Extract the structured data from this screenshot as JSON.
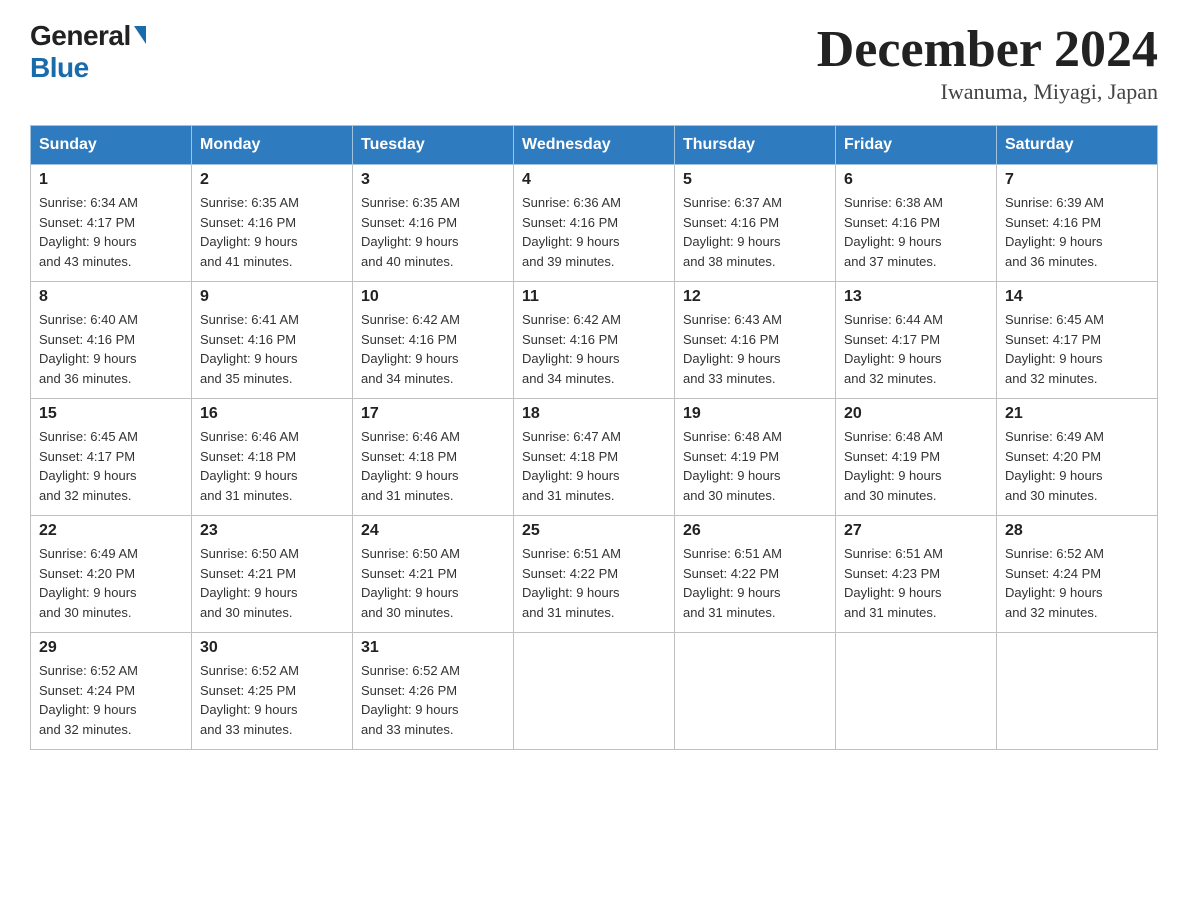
{
  "logo": {
    "line1": "General",
    "line2": "Blue"
  },
  "title": "December 2024",
  "subtitle": "Iwanuma, Miyagi, Japan",
  "weekdays": [
    "Sunday",
    "Monday",
    "Tuesday",
    "Wednesday",
    "Thursday",
    "Friday",
    "Saturday"
  ],
  "weeks": [
    [
      {
        "day": "1",
        "sunrise": "6:34 AM",
        "sunset": "4:17 PM",
        "daylight": "9 hours and 43 minutes."
      },
      {
        "day": "2",
        "sunrise": "6:35 AM",
        "sunset": "4:16 PM",
        "daylight": "9 hours and 41 minutes."
      },
      {
        "day": "3",
        "sunrise": "6:35 AM",
        "sunset": "4:16 PM",
        "daylight": "9 hours and 40 minutes."
      },
      {
        "day": "4",
        "sunrise": "6:36 AM",
        "sunset": "4:16 PM",
        "daylight": "9 hours and 39 minutes."
      },
      {
        "day": "5",
        "sunrise": "6:37 AM",
        "sunset": "4:16 PM",
        "daylight": "9 hours and 38 minutes."
      },
      {
        "day": "6",
        "sunrise": "6:38 AM",
        "sunset": "4:16 PM",
        "daylight": "9 hours and 37 minutes."
      },
      {
        "day": "7",
        "sunrise": "6:39 AM",
        "sunset": "4:16 PM",
        "daylight": "9 hours and 36 minutes."
      }
    ],
    [
      {
        "day": "8",
        "sunrise": "6:40 AM",
        "sunset": "4:16 PM",
        "daylight": "9 hours and 36 minutes."
      },
      {
        "day": "9",
        "sunrise": "6:41 AM",
        "sunset": "4:16 PM",
        "daylight": "9 hours and 35 minutes."
      },
      {
        "day": "10",
        "sunrise": "6:42 AM",
        "sunset": "4:16 PM",
        "daylight": "9 hours and 34 minutes."
      },
      {
        "day": "11",
        "sunrise": "6:42 AM",
        "sunset": "4:16 PM",
        "daylight": "9 hours and 34 minutes."
      },
      {
        "day": "12",
        "sunrise": "6:43 AM",
        "sunset": "4:16 PM",
        "daylight": "9 hours and 33 minutes."
      },
      {
        "day": "13",
        "sunrise": "6:44 AM",
        "sunset": "4:17 PM",
        "daylight": "9 hours and 32 minutes."
      },
      {
        "day": "14",
        "sunrise": "6:45 AM",
        "sunset": "4:17 PM",
        "daylight": "9 hours and 32 minutes."
      }
    ],
    [
      {
        "day": "15",
        "sunrise": "6:45 AM",
        "sunset": "4:17 PM",
        "daylight": "9 hours and 32 minutes."
      },
      {
        "day": "16",
        "sunrise": "6:46 AM",
        "sunset": "4:18 PM",
        "daylight": "9 hours and 31 minutes."
      },
      {
        "day": "17",
        "sunrise": "6:46 AM",
        "sunset": "4:18 PM",
        "daylight": "9 hours and 31 minutes."
      },
      {
        "day": "18",
        "sunrise": "6:47 AM",
        "sunset": "4:18 PM",
        "daylight": "9 hours and 31 minutes."
      },
      {
        "day": "19",
        "sunrise": "6:48 AM",
        "sunset": "4:19 PM",
        "daylight": "9 hours and 30 minutes."
      },
      {
        "day": "20",
        "sunrise": "6:48 AM",
        "sunset": "4:19 PM",
        "daylight": "9 hours and 30 minutes."
      },
      {
        "day": "21",
        "sunrise": "6:49 AM",
        "sunset": "4:20 PM",
        "daylight": "9 hours and 30 minutes."
      }
    ],
    [
      {
        "day": "22",
        "sunrise": "6:49 AM",
        "sunset": "4:20 PM",
        "daylight": "9 hours and 30 minutes."
      },
      {
        "day": "23",
        "sunrise": "6:50 AM",
        "sunset": "4:21 PM",
        "daylight": "9 hours and 30 minutes."
      },
      {
        "day": "24",
        "sunrise": "6:50 AM",
        "sunset": "4:21 PM",
        "daylight": "9 hours and 30 minutes."
      },
      {
        "day": "25",
        "sunrise": "6:51 AM",
        "sunset": "4:22 PM",
        "daylight": "9 hours and 31 minutes."
      },
      {
        "day": "26",
        "sunrise": "6:51 AM",
        "sunset": "4:22 PM",
        "daylight": "9 hours and 31 minutes."
      },
      {
        "day": "27",
        "sunrise": "6:51 AM",
        "sunset": "4:23 PM",
        "daylight": "9 hours and 31 minutes."
      },
      {
        "day": "28",
        "sunrise": "6:52 AM",
        "sunset": "4:24 PM",
        "daylight": "9 hours and 32 minutes."
      }
    ],
    [
      {
        "day": "29",
        "sunrise": "6:52 AM",
        "sunset": "4:24 PM",
        "daylight": "9 hours and 32 minutes."
      },
      {
        "day": "30",
        "sunrise": "6:52 AM",
        "sunset": "4:25 PM",
        "daylight": "9 hours and 33 minutes."
      },
      {
        "day": "31",
        "sunrise": "6:52 AM",
        "sunset": "4:26 PM",
        "daylight": "9 hours and 33 minutes."
      },
      null,
      null,
      null,
      null
    ]
  ],
  "labels": {
    "sunrise": "Sunrise:",
    "sunset": "Sunset:",
    "daylight": "Daylight:"
  }
}
